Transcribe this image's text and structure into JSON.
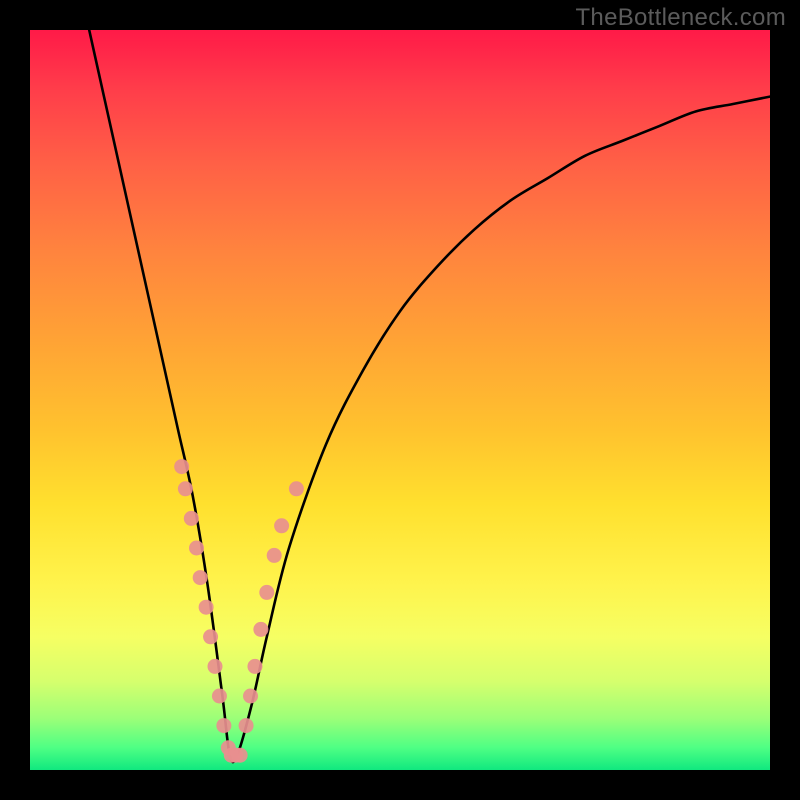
{
  "watermark": "TheBottleneck.com",
  "chart_data": {
    "type": "line",
    "title": "",
    "xlabel": "",
    "ylabel": "",
    "xlim": [
      0,
      100
    ],
    "ylim": [
      0,
      100
    ],
    "background_gradient": [
      "#ff1a48",
      "#ffa335",
      "#fff24a",
      "#10e87f"
    ],
    "series": [
      {
        "name": "bottleneck-curve",
        "x": [
          8,
          10,
          12,
          14,
          16,
          18,
          20,
          22,
          24,
          26,
          27,
          28,
          30,
          32,
          35,
          40,
          45,
          50,
          55,
          60,
          65,
          70,
          75,
          80,
          85,
          90,
          95,
          100
        ],
        "values": [
          100,
          91,
          82,
          73,
          64,
          55,
          46,
          37,
          25,
          10,
          2,
          2,
          9,
          18,
          30,
          44,
          54,
          62,
          68,
          73,
          77,
          80,
          83,
          85,
          87,
          89,
          90,
          91
        ]
      }
    ],
    "marker_clusters": [
      {
        "name": "left-arm-markers",
        "color": "#e88f8f",
        "points": [
          {
            "x": 20.5,
            "y": 41
          },
          {
            "x": 21.0,
            "y": 38
          },
          {
            "x": 21.8,
            "y": 34
          },
          {
            "x": 22.5,
            "y": 30
          },
          {
            "x": 23.0,
            "y": 26
          },
          {
            "x": 23.8,
            "y": 22
          },
          {
            "x": 24.4,
            "y": 18
          },
          {
            "x": 25.0,
            "y": 14
          },
          {
            "x": 25.6,
            "y": 10
          },
          {
            "x": 26.2,
            "y": 6
          },
          {
            "x": 26.8,
            "y": 3
          }
        ]
      },
      {
        "name": "valley-markers",
        "color": "#e88f8f",
        "points": [
          {
            "x": 27.2,
            "y": 2
          },
          {
            "x": 27.8,
            "y": 2
          },
          {
            "x": 28.4,
            "y": 2
          }
        ]
      },
      {
        "name": "right-arm-markers",
        "color": "#e88f8f",
        "points": [
          {
            "x": 29.2,
            "y": 6
          },
          {
            "x": 29.8,
            "y": 10
          },
          {
            "x": 30.4,
            "y": 14
          },
          {
            "x": 31.2,
            "y": 19
          },
          {
            "x": 32.0,
            "y": 24
          },
          {
            "x": 33.0,
            "y": 29
          },
          {
            "x": 34.0,
            "y": 33
          },
          {
            "x": 36.0,
            "y": 38
          }
        ]
      }
    ]
  }
}
